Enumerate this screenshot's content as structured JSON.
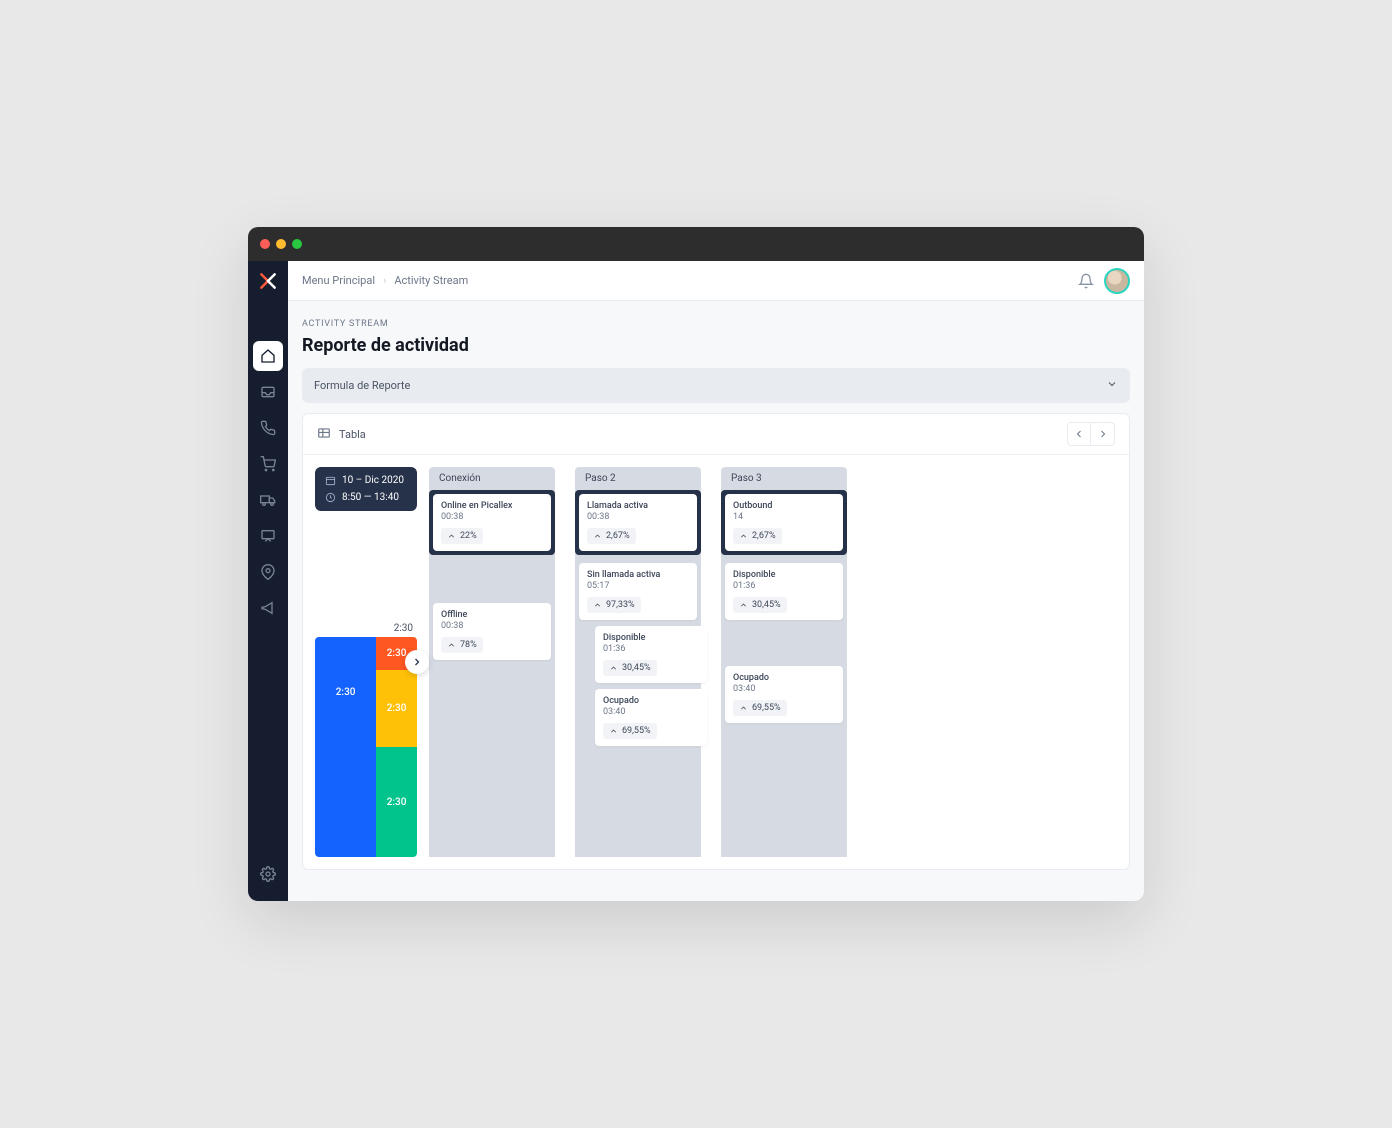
{
  "breadcrumb": {
    "root": "Menu Principal",
    "current": "Activity Stream"
  },
  "eyebrow": "ACTIVITY STREAM",
  "page_title": "Reporte de actividad",
  "formula_bar": {
    "label": "Formula de Reporte"
  },
  "panel_head": {
    "tab": "Tabla"
  },
  "date": {
    "date_label": "10 – Dic 2020",
    "time_label": "8:50 — 13:40"
  },
  "stack_top_label": "2:30",
  "stack": {
    "blue": "2:30",
    "orange": "2:30",
    "yellow": "2:30",
    "green": "2:30"
  },
  "columns": [
    {
      "header": "Conexión",
      "primary": {
        "title": "Online en Picallex",
        "sub": "00:38",
        "chip": "22%"
      },
      "cards": [
        {
          "title": "Offline",
          "sub": "00:38",
          "chip": "78%"
        }
      ]
    },
    {
      "header": "Paso 2",
      "primary": {
        "title": "Llamada activa",
        "sub": "00:38",
        "chip": "2,67%"
      },
      "cards": [
        {
          "title": "Sin llamada activa",
          "sub": "05:17",
          "chip": "97,33%"
        },
        {
          "title": "Disponible",
          "sub": "01:36",
          "chip": "30,45%",
          "nested": true
        },
        {
          "title": "Ocupado",
          "sub": "03:40",
          "chip": "69,55%",
          "nested": true
        }
      ]
    },
    {
      "header": "Paso 3",
      "primary": {
        "title": "Outbound",
        "sub": "14",
        "chip": "2,67%"
      },
      "cards": [
        {
          "title": "Disponible",
          "sub": "01:36",
          "chip": "30,45%"
        },
        {
          "title": "Ocupado",
          "sub": "03:40",
          "chip": "69,55%",
          "gap": true
        }
      ]
    }
  ]
}
